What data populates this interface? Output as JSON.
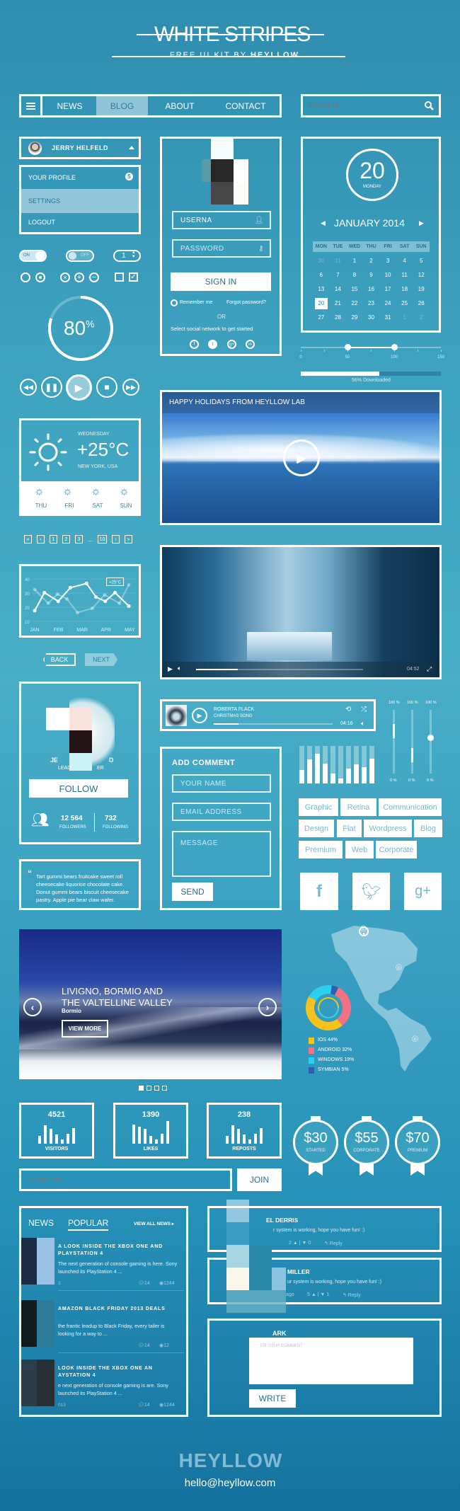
{
  "header": {
    "title": "WHITE STRIPES",
    "subtitle_prefix": "FREE UI KIT BY ",
    "subtitle_brand": "HEYLLOW"
  },
  "nav": {
    "items": [
      {
        "label": "NEWS"
      },
      {
        "label": "BLOG",
        "active": true
      },
      {
        "label": "ABOUT"
      },
      {
        "label": "CONTACT"
      }
    ],
    "menu_icon": "hamburger-icon"
  },
  "search": {
    "placeholder": "SEARCH",
    "icon": "search-icon"
  },
  "user_menu": {
    "name": "JERRY HELFELD",
    "items": [
      {
        "label": "YOUR PROFILE",
        "badge": "5"
      },
      {
        "label": "SETTINGS",
        "active": true
      },
      {
        "label": "LOGOUT"
      }
    ]
  },
  "controls": {
    "toggle_on": "ON",
    "toggle_off": "OFF",
    "stepper_value": "1",
    "progress_circle": "80",
    "progress_unit": "%"
  },
  "login": {
    "username_placeholder": "USERNA",
    "password_placeholder": "PASSWORD",
    "sign_in": "SIGN IN",
    "remember": "Remember me",
    "forgot": "Forgot password?",
    "or": "OR",
    "social_text": "Select social network to get started",
    "social": [
      "facebook-icon",
      "twitter-icon",
      "google-plus-icon",
      "linkedin-icon"
    ]
  },
  "calendar": {
    "day": "20",
    "weekday": "MONDAY",
    "month": "JANUARY 2014",
    "headers": [
      "MON",
      "TUE",
      "WED",
      "THU",
      "FRI",
      "SAT",
      "SUN"
    ],
    "days": [
      [
        "30",
        "31",
        "1",
        "2",
        "3",
        "4",
        "5"
      ],
      [
        "6",
        "7",
        "8",
        "9",
        "10",
        "11",
        "12"
      ],
      [
        "13",
        "14",
        "15",
        "16",
        "17",
        "18",
        "19"
      ],
      [
        "20",
        "21",
        "22",
        "23",
        "24",
        "25",
        "26"
      ],
      [
        "27",
        "28",
        "29",
        "30",
        "31",
        "1",
        "2"
      ]
    ],
    "selected": "20"
  },
  "range_slider": {
    "ticks": [
      "0",
      "50",
      "100",
      "150"
    ],
    "min": 0,
    "max": 150,
    "low": 50,
    "high": 100
  },
  "download": {
    "percent": 56,
    "label": "56% Downloaded"
  },
  "weather": {
    "weekday": "WEDNESDAY",
    "temp": "+25°C",
    "location": "NEW YORK, USA",
    "forecast": [
      "THU",
      "FRI",
      "SAT",
      "SUN"
    ]
  },
  "pagination": {
    "items": [
      "«",
      "‹",
      "1",
      "2",
      "3",
      "...",
      "10",
      "›",
      "»"
    ]
  },
  "line_chart": {
    "yticks": [
      "40",
      "30",
      "20",
      "10"
    ],
    "xticks": [
      "JAN",
      "FEB",
      "MAR",
      "APR",
      "MAY"
    ],
    "annotation": "+25°C",
    "series_main": [
      [
        0,
        17.5
      ],
      [
        0.41,
        30.3
      ],
      [
        0.99,
        24.2
      ],
      [
        1.5,
        33.8
      ],
      [
        2.18,
        36.8
      ],
      [
        2.58,
        27.2
      ],
      [
        2.97,
        24.2
      ],
      [
        3.38,
        30.3
      ],
      [
        3.96,
        20.8
      ]
    ],
    "series_secondary": [
      [
        0,
        32.5
      ],
      [
        0.57,
        22.8
      ],
      [
        0.96,
        29.2
      ],
      [
        1.36,
        25.8
      ],
      [
        1.8,
        16.2
      ],
      [
        2.42,
        19.2
      ],
      [
        2.94,
        28.7
      ],
      [
        3.56,
        22.8
      ],
      [
        3.96,
        35.8
      ]
    ]
  },
  "wizard": {
    "back": "BACK",
    "next": "NEXT"
  },
  "video1": {
    "title": "HAPPY HOLIDAYS FROM HEYLLOW LAB"
  },
  "video2": {
    "time": "04:52",
    "progress": 0.25
  },
  "profile": {
    "name": "JE",
    "name_end": "D",
    "role": "LEAD",
    "role_end": "ER",
    "follow": "FOLLOW",
    "followers": "12 564",
    "followers_label": "FOLLOWERS",
    "following": "732",
    "following_label": "FOLLOWING"
  },
  "quote": {
    "text": "Tart gummi bears fruitcake sweet roll cheesecake liquorice chocolate cake. Donut gummi bears biscuit cheesecake pastry. Apple pie bear claw wafer."
  },
  "player": {
    "artist": "ROBERTA FLACK",
    "song": "CHRISTMAS SONG",
    "time": "04:16",
    "progress": 0.21
  },
  "vsliders": {
    "max_label": "100 %",
    "min_label": "0 %",
    "values": [
      0.78,
      0.4,
      0.61
    ]
  },
  "equalizer": {
    "values": [
      0.35,
      0.65,
      0.8,
      0.52,
      0.27,
      0.13,
      0.39,
      0.51,
      0.43,
      0.67
    ]
  },
  "comment_form": {
    "title": "ADD COMMENT",
    "name": "YOUR NAME",
    "email": "EMAIL ADDRESS",
    "message": "MESSAGE",
    "send": "SEND"
  },
  "tags": [
    "Graphic",
    "Retina",
    "Communication",
    "Design",
    "Flat",
    "Wordpress",
    "Blog",
    "Premium",
    "Web",
    "Corporate"
  ],
  "social_buttons": [
    "facebook-icon",
    "twitter-icon",
    "google-plus-icon"
  ],
  "slider": {
    "title1": "LIVIGNO,  BORMIO AND",
    "title2": "THE VALTELLINE VALLEY",
    "subtitle": "Bormio",
    "button": "VIEW MORE",
    "slides": 4,
    "active": 0
  },
  "donut": {
    "type": "pie",
    "items": [
      {
        "label": "IOS",
        "value": 44,
        "color": "#f5c21b"
      },
      {
        "label": "ANDROID",
        "value": 32,
        "color": "#f27285"
      },
      {
        "label": "WINDOWS",
        "value": 19,
        "color": "#2ad0f0"
      },
      {
        "label": "SYMBIAN",
        "value": 5,
        "color": "#2c5fb0"
      }
    ]
  },
  "stats": [
    {
      "value": "4521",
      "label": "VISITORS",
      "bars": [
        0.35,
        0.8,
        0.65,
        0.4,
        0.2,
        0.45,
        0.7
      ]
    },
    {
      "value": "1390",
      "label": "LIKES",
      "bars": [
        0.85,
        0.75,
        0.65,
        0.35,
        0.2,
        0.45,
        1.0
      ]
    },
    {
      "value": "238",
      "label": "REPOSTS",
      "bars": [
        0.35,
        0.8,
        0.65,
        0.4,
        0.2,
        0.45,
        0.7
      ]
    }
  ],
  "pricing": [
    {
      "price": "$30",
      "label": "STARTED"
    },
    {
      "price": "$55",
      "label": "CORPORATE"
    },
    {
      "price": "$70",
      "label": "PREMIUM"
    }
  ],
  "newsletter": {
    "placeholder": "YOUR EMAIL",
    "button": "JOIN"
  },
  "news": {
    "tabs": [
      "NEWS",
      "POPULAR"
    ],
    "view_all": "VIEW ALL NEWS",
    "items": [
      {
        "title": "A LOOK INSIDE THE XBOX ONE AND PLAYSTATION 4",
        "desc": "The next generation of console gaming is here. Sony launched its PlayStation 4 ...",
        "date": "3",
        "comments": "14",
        "views": "1244"
      },
      {
        "title": "AMAZON BLACK FRIDAY 2013 DEALS",
        "desc": "the frantic leadup to Black Friday, every tailer is looking for a way to ...",
        "date": "",
        "comments": "14",
        "views": "12"
      },
      {
        "title": "LOOK INSIDE THE XBOX ONE AN AYSTATION 4",
        "desc": "e next generation of console gaming is are. Sony launched its PlayStation 4 ...",
        "date": "013",
        "comments": "14",
        "views": "1244"
      }
    ]
  },
  "comments": [
    {
      "name": "EL DERRIS",
      "text": "r system is working, hope you have fun! :)",
      "up": "2",
      "down": "0",
      "reply": "Reply"
    },
    {
      "name": "MILLER",
      "text": "ur system is working, hope you have fun! :)",
      "ago": "ago",
      "up": "5",
      "down": "1",
      "reply": "Reply"
    }
  ],
  "comment_write": {
    "name": "ARK",
    "placeholder": "ER YOUR COMMENT",
    "button": "WRITE"
  },
  "footer": {
    "logo": "HEYLLOW",
    "email": "hello@heyllow.com"
  }
}
